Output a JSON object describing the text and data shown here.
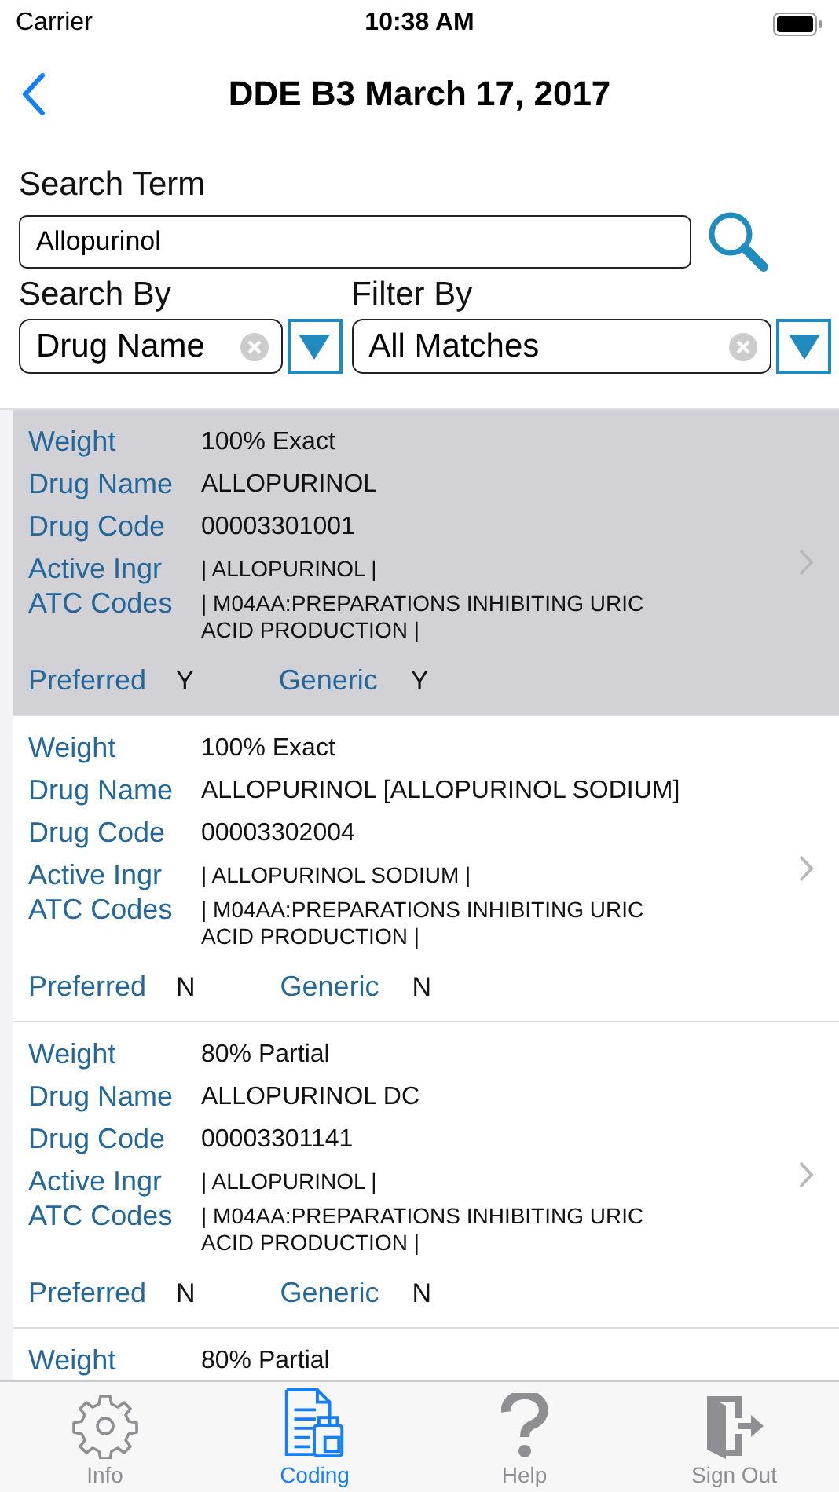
{
  "status_bar": {
    "carrier": "Carrier",
    "time": "10:38 AM"
  },
  "nav": {
    "title": "DDE B3 March 17, 2017"
  },
  "search": {
    "label": "Search Term",
    "value": "Allopurinol"
  },
  "search_by": {
    "label": "Search By",
    "value": "Drug Name"
  },
  "filter_by": {
    "label": "Filter By",
    "value": "All Matches"
  },
  "results": [
    {
      "selected": true,
      "weight_label": "Weight",
      "weight": "100% Exact",
      "name_label": "Drug Name",
      "name": "ALLOPURINOL",
      "code_label": "Drug Code",
      "code": "00003301001",
      "ingr_label": "Active Ingr",
      "ingr": "| ALLOPURINOL |",
      "atc_label": "ATC Codes",
      "atc": "| M04AA:PREPARATIONS INHIBITING URIC ACID PRODUCTION |",
      "preferred_label": "Preferred",
      "preferred": "Y",
      "generic_label": "Generic",
      "generic": "Y"
    },
    {
      "selected": false,
      "weight_label": "Weight",
      "weight": "100% Exact",
      "name_label": "Drug Name",
      "name": "ALLOPURINOL [ALLOPURINOL SODIUM]",
      "code_label": "Drug Code",
      "code": "00003302004",
      "ingr_label": "Active Ingr",
      "ingr": "| ALLOPURINOL SODIUM |",
      "atc_label": "ATC Codes",
      "atc": "| M04AA:PREPARATIONS INHIBITING URIC ACID PRODUCTION |",
      "preferred_label": "Preferred",
      "preferred": "N",
      "generic_label": "Generic",
      "generic": "N"
    },
    {
      "selected": false,
      "weight_label": "Weight",
      "weight": "80% Partial",
      "name_label": "Drug Name",
      "name": "ALLOPURINOL DC",
      "code_label": "Drug Code",
      "code": "00003301141",
      "ingr_label": "Active Ingr",
      "ingr": "| ALLOPURINOL |",
      "atc_label": "ATC Codes",
      "atc": "| M04AA:PREPARATIONS INHIBITING URIC ACID PRODUCTION |",
      "preferred_label": "Preferred",
      "preferred": "N",
      "generic_label": "Generic",
      "generic": "N"
    },
    {
      "selected": false,
      "weight_label": "Weight",
      "weight": "80% Partial"
    }
  ],
  "tabs": [
    {
      "kind": "gear",
      "label": "Info",
      "selected": false
    },
    {
      "kind": "document",
      "label": "Coding",
      "selected": true
    },
    {
      "kind": "question",
      "label": "Help",
      "selected": false
    },
    {
      "kind": "exit",
      "label": "Sign Out",
      "selected": false
    }
  ]
}
